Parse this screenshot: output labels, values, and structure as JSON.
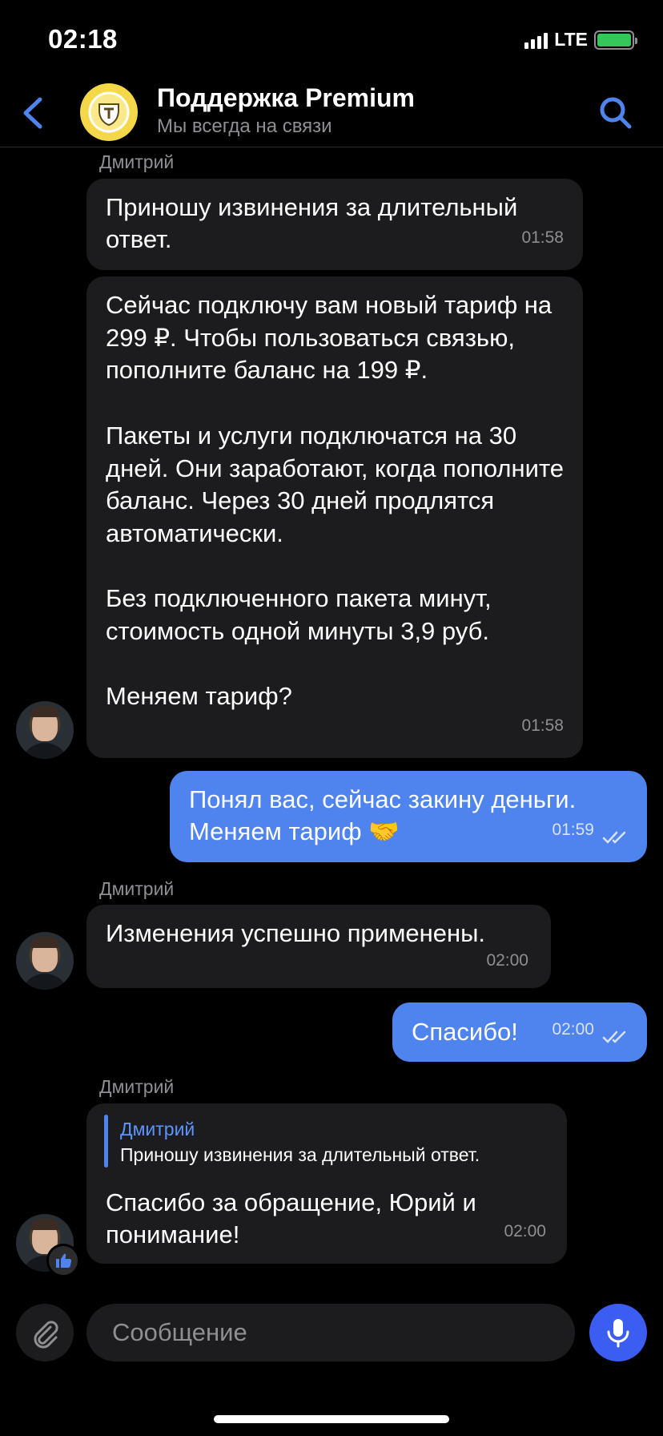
{
  "status": {
    "time": "02:18",
    "network": "LTE"
  },
  "header": {
    "title": "Поддержка Premium",
    "subtitle": "Мы всегда на связи"
  },
  "messages": [
    {
      "sender": "Дмитрий",
      "text": "Приношу извинения за длительный ответ.",
      "time": "01:58"
    },
    {
      "text": "Сейчас подключу вам новый тариф на 299 ₽. Чтобы пользоваться связью, пополните баланс на 199 ₽.\n\nПакеты и услуги подключатся на 30 дней. Они заработают, когда пополните баланс. Через 30 дней продлятся автоматически.\n\nБез подключенного пакета минут, стоимость одной минуты 3,9 руб.\n\nМеняем тариф?",
      "time": "01:58"
    },
    {
      "text": "Понял вас, сейчас закину деньги. Меняем тариф 🤝",
      "time": "01:59"
    },
    {
      "sender": "Дмитрий",
      "text": "Изменения успешно применены.",
      "time": "02:00"
    },
    {
      "text": "Спасибо!",
      "time": "02:00"
    },
    {
      "sender": "Дмитрий",
      "reply_name": "Дмитрий",
      "reply_text": "Приношу извинения за длительный ответ.",
      "text": "Спасибо за обращение, Юрий и понимание!",
      "time": "02:00"
    }
  ],
  "input": {
    "placeholder": "Сообщение"
  },
  "icons": {
    "back": "chevron-left-icon",
    "search": "search-icon",
    "attach": "paperclip-icon",
    "mic": "microphone-icon",
    "like": "thumbs-up-icon"
  },
  "colors": {
    "outgoing": "#4f84ee",
    "incoming": "#1c1c1e",
    "accent": "#3c5df2"
  }
}
